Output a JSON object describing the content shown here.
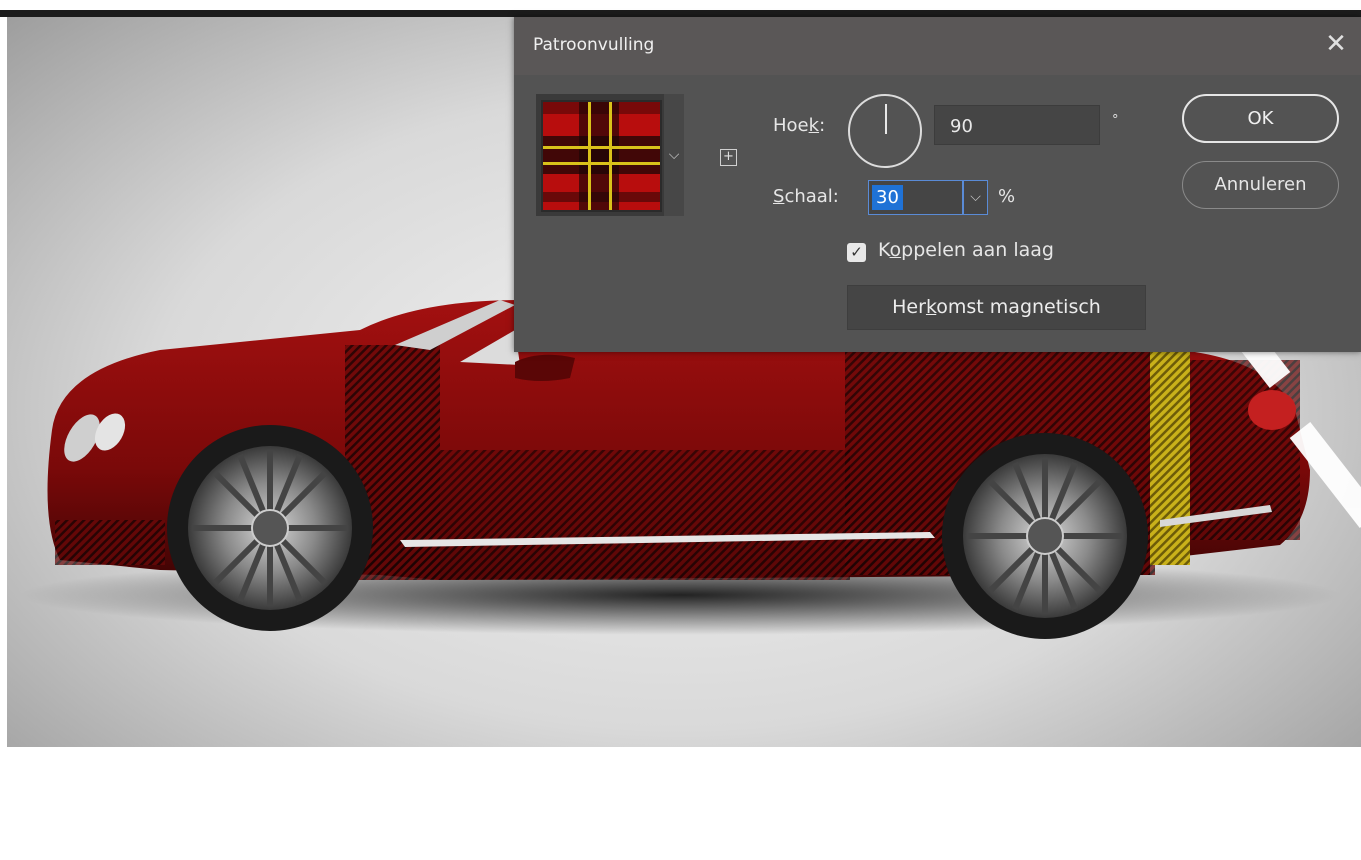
{
  "dialog": {
    "title": "Patroonvulling",
    "angle_label_prefix": "Hoe",
    "angle_label_underlined": "k",
    "angle_label_suffix": ":",
    "angle_value": "90",
    "angle_unit": "°",
    "scale_label_underlined": "S",
    "scale_label_rest": "chaal:",
    "scale_value": "30",
    "scale_unit": "%",
    "link_label_prefix": "K",
    "link_label_underlined": "o",
    "link_label_rest": "ppelen aan laag",
    "link_checked": true,
    "snap_label_prefix": "Her",
    "snap_label_underlined": "k",
    "snap_label_rest": "omst magnetisch",
    "ok_label": "OK",
    "cancel_label": "Annuleren",
    "close_glyph": "✕",
    "chevron_glyph": "⌵",
    "new_preset_glyph": "+"
  },
  "canvas": {
    "subject": "car-with-tartan-pattern",
    "pattern_colors": {
      "red": "#b80d0d",
      "dark": "#1a0606",
      "yellow": "#d9c21a"
    },
    "car_body_color": "#7e0a0a"
  },
  "icons": [
    "close-icon",
    "angle-dial-icon",
    "chevron-down-icon",
    "new-preset-icon",
    "checkbox-check-icon"
  ]
}
